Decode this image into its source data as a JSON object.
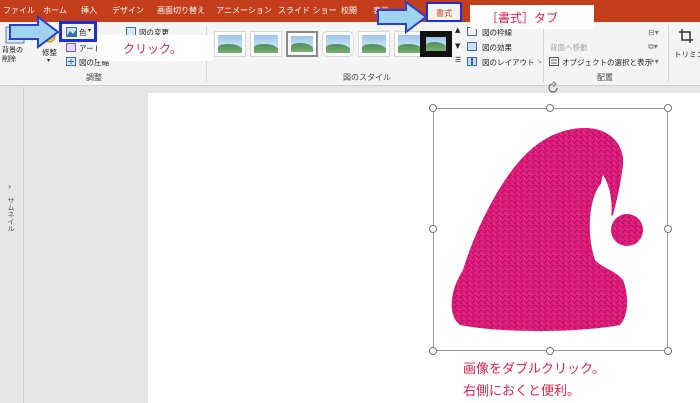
{
  "tabs": [
    {
      "label": "ファイル"
    },
    {
      "label": "ホーム"
    },
    {
      "label": "挿入"
    },
    {
      "label": "デザイン"
    },
    {
      "label": "画面切り替え"
    },
    {
      "label": "アニメーション"
    },
    {
      "label": "スライド ショー"
    },
    {
      "label": "校閲"
    },
    {
      "label": "表示"
    },
    {
      "label": "書式"
    }
  ],
  "ribbon": {
    "remove_bg": "背景の\n削除",
    "corrections": "修整",
    "color": "色",
    "artistic": "アート効果",
    "compress": "図の圧縮",
    "change_picture": "図の変更",
    "reset_picture": "図のリセット",
    "adjust_group": "調整",
    "styles_group": "図のスタイル",
    "picture_border": "図の枠線",
    "picture_effects": "図の効果",
    "picture_layout": "図のレイアウト",
    "send_backward": "背面へ移動",
    "selection_pane": "オブジェクトの選択と表示",
    "arrange_group": "配置",
    "crop": "トリミング"
  },
  "callouts": {
    "tab_callout": "［書式］タブ",
    "click_callout": "クリック。"
  },
  "thumb_label": "サムネイル",
  "notes": {
    "line1": "画像をダブルクリック。",
    "line2": "右側におくと便利。"
  },
  "colors": {
    "accent": "#c43e1c",
    "callout_text": "#e0204a",
    "highlight_border": "#1e2fd6",
    "hat": "#e0197d"
  }
}
